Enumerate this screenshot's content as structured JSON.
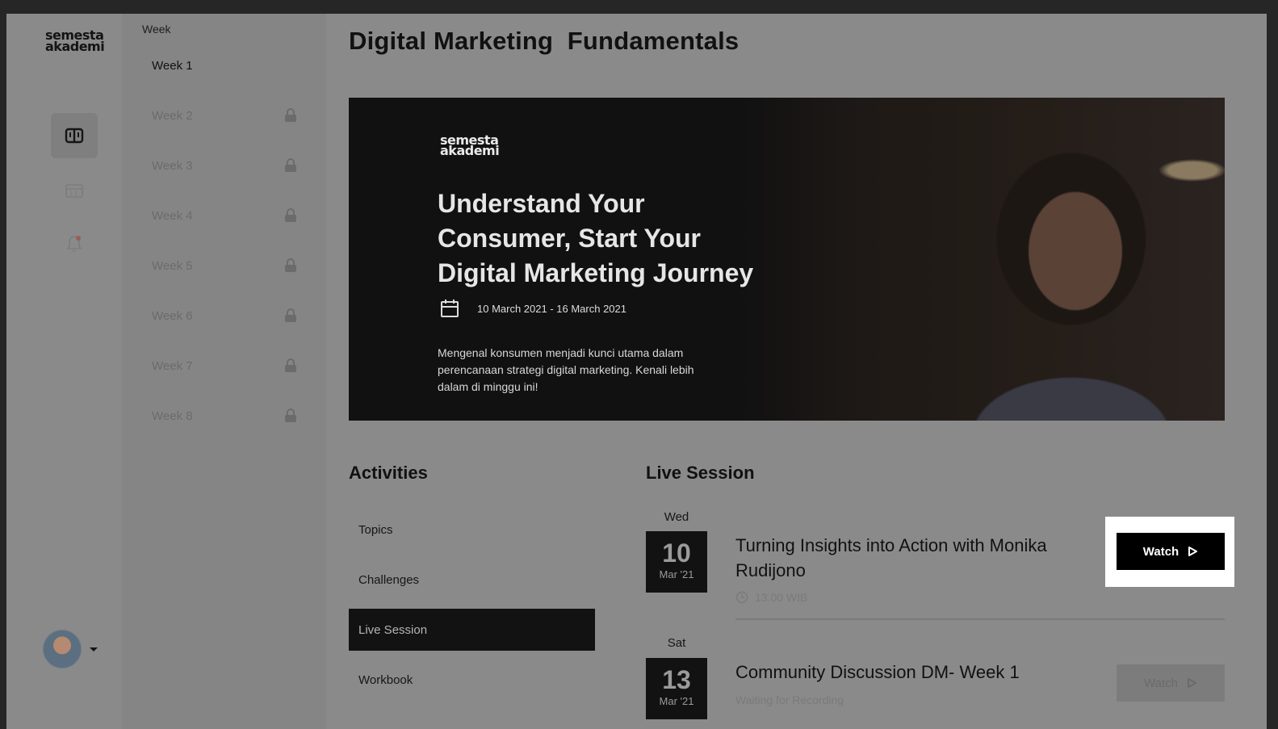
{
  "brand": {
    "logo_line1": "semesta",
    "logo_line2": "akademi"
  },
  "rail": {
    "icons": [
      "book-icon",
      "calendar-icon",
      "bell-icon"
    ]
  },
  "weeks": {
    "title": "Week",
    "items": [
      {
        "label": "Week 1",
        "locked": false
      },
      {
        "label": "Week 2",
        "locked": true
      },
      {
        "label": "Week 3",
        "locked": true
      },
      {
        "label": "Week 4",
        "locked": true
      },
      {
        "label": "Week 5",
        "locked": true
      },
      {
        "label": "Week 6",
        "locked": true
      },
      {
        "label": "Week 7",
        "locked": true
      },
      {
        "label": "Week 8",
        "locked": true
      }
    ]
  },
  "page": {
    "title": "Digital Marketing  Fundamentals"
  },
  "banner": {
    "logo_line1": "semesta",
    "logo_line2": "akademi",
    "headline": "Understand Your Consumer, Start Your Digital Marketing Journey",
    "date_range": "10 March 2021 - 16 March 2021",
    "description": "Mengenal konsumen menjadi kunci utama dalam perencanaan strategi digital marketing. Kenali lebih dalam di minggu ini!"
  },
  "activities": {
    "heading": "Activities",
    "items": [
      "Topics",
      "Challenges",
      "Live Session",
      "Workbook"
    ],
    "selected": "Live Session"
  },
  "live": {
    "heading": "Live Session",
    "sessions": [
      {
        "weekday": "Wed",
        "day": "10",
        "month": "Mar '21",
        "title": "Turning Insights into Action with Monika Rudijono",
        "meta": "13.00 WIB",
        "button": "Watch"
      },
      {
        "weekday": "Sat",
        "day": "13",
        "month": "Mar '21",
        "title": "Community Discussion DM- Week 1",
        "meta": "Waiting for Recording",
        "button": "Watch"
      }
    ]
  },
  "colors": {
    "overlay": "#8a8a8a",
    "dark": "#121212",
    "highlight": "#ffffff"
  }
}
